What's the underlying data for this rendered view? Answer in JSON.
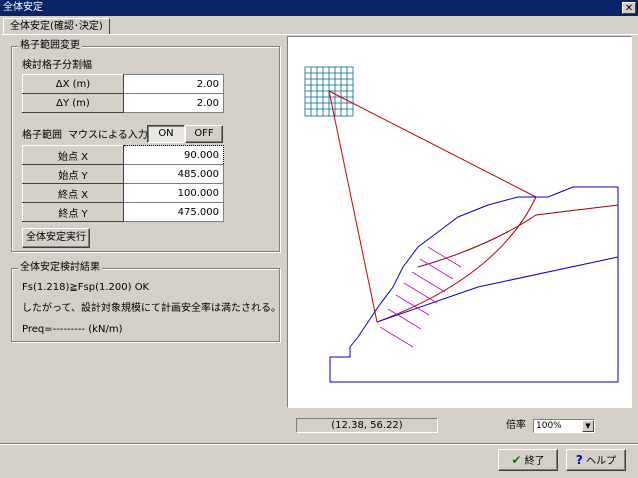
{
  "window": {
    "title": "全体安定",
    "close_glyph": "✕"
  },
  "tabs": [
    {
      "label": "全体安定(確認･決定)"
    }
  ],
  "grid_range": {
    "group_title": "格子範囲変更",
    "division_label": "検討格子分割幅",
    "rows": [
      {
        "label": "ΔX (m)",
        "value": "2.00"
      },
      {
        "label": "ΔY (m)",
        "value": "2.00"
      }
    ],
    "range_label": "格子範囲",
    "mouse_label": "マウスによる入力",
    "on_label": "ON",
    "off_label": "OFF",
    "points": [
      {
        "label": "始点 X",
        "value": "90.000"
      },
      {
        "label": "始点 Y",
        "value": "485.000"
      },
      {
        "label": "終点 X",
        "value": "100.000"
      },
      {
        "label": "終点 Y",
        "value": "475.000"
      }
    ],
    "execute_label": "全体安定実行"
  },
  "result": {
    "group_title": "全体安定検討結果",
    "line1": "Fs(1.218)≧Fsp(1.200)    OK",
    "line2": "したがって、設計対象規模にて計画安全率は満たされる。",
    "line3": "Preq=--------- (kN/m)"
  },
  "canvas": {
    "coords": "(12.38, 56.22)",
    "zoom_label": "倍率",
    "zoom_value": "100%"
  },
  "footer": {
    "ok_label": "終了",
    "help_label": "ヘルプ"
  },
  "colors": {
    "ground": "#0000cc",
    "failure_line": "#cc0000",
    "layer_boundary": "#990000",
    "grid": "#006699",
    "reinforcement": "#cc00cc"
  }
}
